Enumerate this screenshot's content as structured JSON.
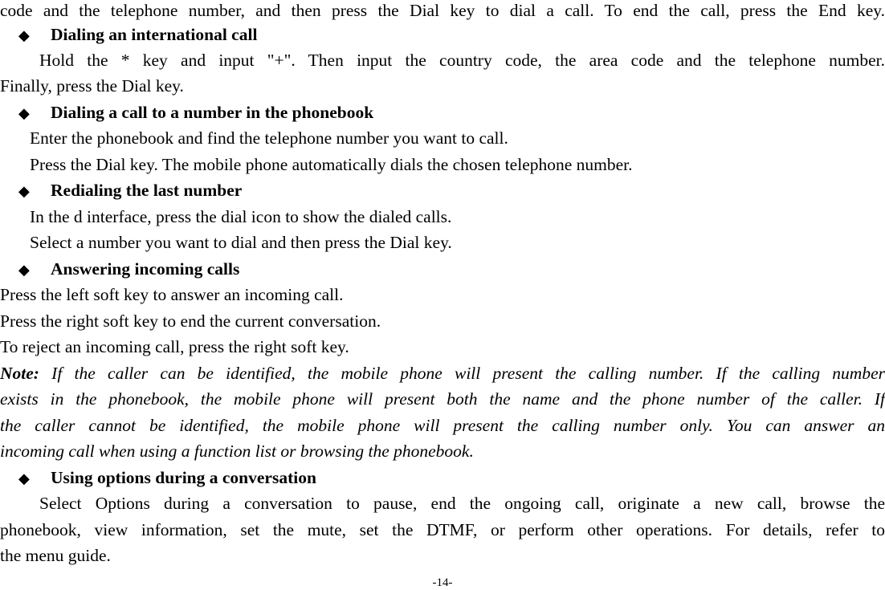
{
  "document": {
    "intro_line": "code and the telephone number, and then press the Dial key to dial a call. To end the call, press the End key.",
    "sections": [
      {
        "bullet_icon": "diamond-bullet",
        "bullet_glyph": "◆",
        "heading": "Dialing an international call",
        "lines": [
          "Hold the * key and input \"+\". Then input the country code, the area code and the telephone number.",
          "Finally, press the Dial key."
        ]
      },
      {
        "bullet_icon": "diamond-bullet",
        "bullet_glyph": "◆",
        "heading": "Dialing a call to a number in the phonebook",
        "lines": [
          "Enter the phonebook and find the telephone number you want to call.",
          "Press the Dial key. The mobile phone automatically dials the chosen telephone number."
        ]
      },
      {
        "bullet_icon": "diamond-bullet",
        "bullet_glyph": "◆",
        "heading": "Redialing the last number",
        "lines": [
          "In the d interface, press the dial icon to show the dialed calls.",
          "Select a number you want to dial and then press the Dial key."
        ]
      },
      {
        "bullet_icon": "diamond-bullet",
        "bullet_glyph": "◆",
        "heading": "Answering incoming calls",
        "lines": [
          "Press the left soft key to answer an incoming call.",
          "Press the right soft key to end the current conversation.",
          "To reject an incoming call, press the right soft key."
        ]
      },
      {
        "bullet_icon": "diamond-bullet",
        "bullet_glyph": "◆",
        "heading": "Using options during a conversation",
        "lines": [
          "Select Options during a conversation to pause, end the ongoing call, originate a new call, browse the",
          "phonebook, view information, set the mute, set the DTMF, or perform other operations. For details, refer to",
          "the menu guide."
        ]
      }
    ],
    "note": {
      "label": "Note:",
      "lines": [
        " If the caller can be identified, the mobile phone will present the calling number. If the calling number",
        "exists in the phonebook, the mobile phone will present both the name and the phone number of the caller. If",
        "the caller cannot be identified, the mobile phone will present the calling number only. You can answer an",
        "incoming call when using a function list or browsing the phonebook."
      ]
    },
    "page_number": "-14-"
  }
}
